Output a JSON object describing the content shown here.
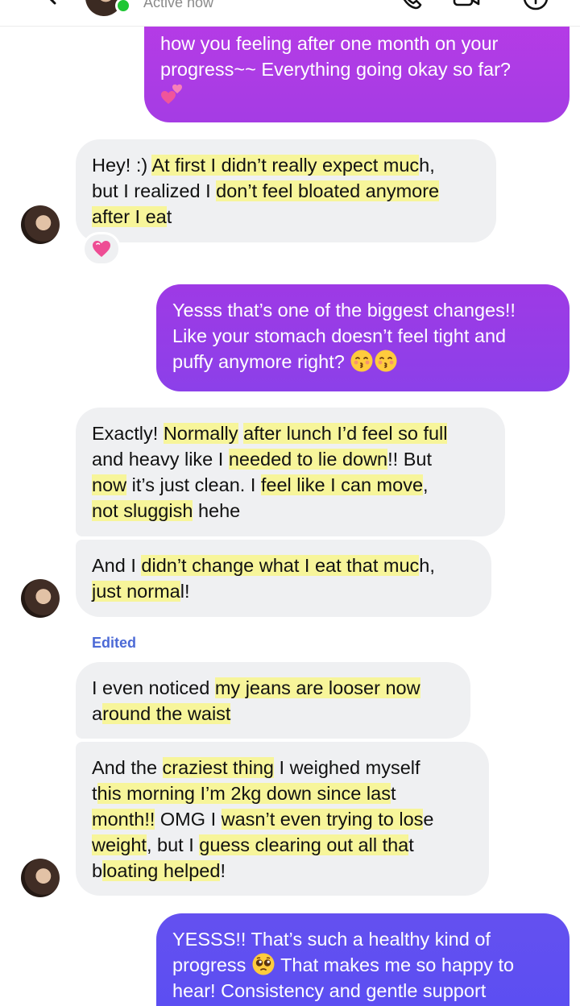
{
  "header": {
    "status": "Active now",
    "online_color": "#1ec634",
    "icons": [
      "back-arrow-icon",
      "avatar",
      "phone-icon",
      "video-camera-icon",
      "info-icon"
    ]
  },
  "messages": [
    {
      "id": "m1",
      "direction": "outgoing",
      "lines": [
        [
          {
            "t": "how you feeling after one month on your"
          }
        ],
        [
          {
            "t": "progress~~ Everything going okay so far?"
          }
        ]
      ],
      "emoji": [
        "two-hearts"
      ]
    },
    {
      "id": "m2",
      "direction": "incoming",
      "lines": [
        [
          {
            "t": "Hey! :) "
          },
          {
            "t": "At first I didn’t really expect muc",
            "hl": true
          },
          {
            "t": "h,"
          }
        ],
        [
          {
            "t": "but I realized I "
          },
          {
            "t": "don’t feel bloated anymore",
            "hl": true
          }
        ],
        [
          {
            "t": "after I ea",
            "hl": true
          },
          {
            "t": "t"
          }
        ]
      ],
      "reaction": "heart-reaction"
    },
    {
      "id": "m3",
      "direction": "outgoing",
      "lines": [
        [
          {
            "t": "Yesss that’s one of the biggest changes!!"
          }
        ],
        [
          {
            "t": "Like your stomach doesn’t feel tight and"
          }
        ],
        [
          {
            "t": "puffy anymore right? "
          }
        ]
      ],
      "emoji": [
        "kissing-face",
        "kissing-face"
      ]
    },
    {
      "id": "m4",
      "direction": "incoming",
      "lines": [
        [
          {
            "t": "Exactly! "
          },
          {
            "t": "Normally",
            "hl": true
          },
          {
            "t": " "
          },
          {
            "t": "after lunch I’d feel so full",
            "hl": true
          }
        ],
        [
          {
            "t": "and heavy like I "
          },
          {
            "t": "needed to lie down",
            "hl": true
          },
          {
            "t": "!! But"
          }
        ],
        [
          {
            "t": "now",
            "hl": true
          },
          {
            "t": " it’s just clean. I "
          },
          {
            "t": "feel like I can move",
            "hl": true
          },
          {
            "t": ","
          }
        ],
        [
          {
            "t": "not sluggish",
            "hl": true
          },
          {
            "t": " hehe"
          }
        ]
      ]
    },
    {
      "id": "m5",
      "direction": "incoming",
      "lines": [
        [
          {
            "t": "And I "
          },
          {
            "t": "didn’t change what I eat that muc",
            "hl": true
          },
          {
            "t": "h,"
          }
        ],
        [
          {
            "t": "just norma",
            "hl": true
          },
          {
            "t": "l!"
          }
        ]
      ]
    },
    {
      "id": "m6",
      "direction": "incoming",
      "edited_label": "Edited",
      "lines": [
        [
          {
            "t": "I even noticed "
          },
          {
            "t": "my jeans are looser now",
            "hl": true
          }
        ],
        [
          {
            "t": "a"
          },
          {
            "t": "round the waist",
            "hl": true
          }
        ]
      ]
    },
    {
      "id": "m7",
      "direction": "incoming",
      "lines": [
        [
          {
            "t": "And the "
          },
          {
            "t": "craziest thing",
            "hl": true
          },
          {
            "t": " I weighed myself"
          }
        ],
        [
          {
            "t": "t"
          },
          {
            "t": "his morning I’m 2kg down since las",
            "hl": true
          },
          {
            "t": "t"
          }
        ],
        [
          {
            "t": "month!!",
            "hl": true
          },
          {
            "t": " OMG I "
          },
          {
            "t": "wasn’t even trying to los",
            "hl": true
          },
          {
            "t": "e"
          }
        ],
        [
          {
            "t": "weight",
            "hl": true
          },
          {
            "t": ", but I "
          },
          {
            "t": "guess clearing out all tha",
            "hl": true
          },
          {
            "t": "t"
          }
        ],
        [
          {
            "t": "b"
          },
          {
            "t": "loating helped",
            "hl": true
          },
          {
            "t": "!"
          }
        ]
      ]
    },
    {
      "id": "m8",
      "direction": "outgoing",
      "lines": [
        [
          {
            "t": "YESSS!! That’s such a healthy kind of"
          }
        ],
        [
          {
            "t": "progress "
          },
          {
            "emoji": "pleading-face"
          },
          {
            "t": " That makes me so happy to"
          }
        ],
        [
          {
            "t": "hear! Consistency and gentle support"
          }
        ]
      ]
    }
  ],
  "colors": {
    "incoming_bubble": "#eff0f2",
    "highlight": "#f7f59a",
    "outgoing_gradient_top": "#b437e3",
    "outgoing_gradient_bottom": "#5a4df0",
    "edited": "#4c6ad6"
  }
}
